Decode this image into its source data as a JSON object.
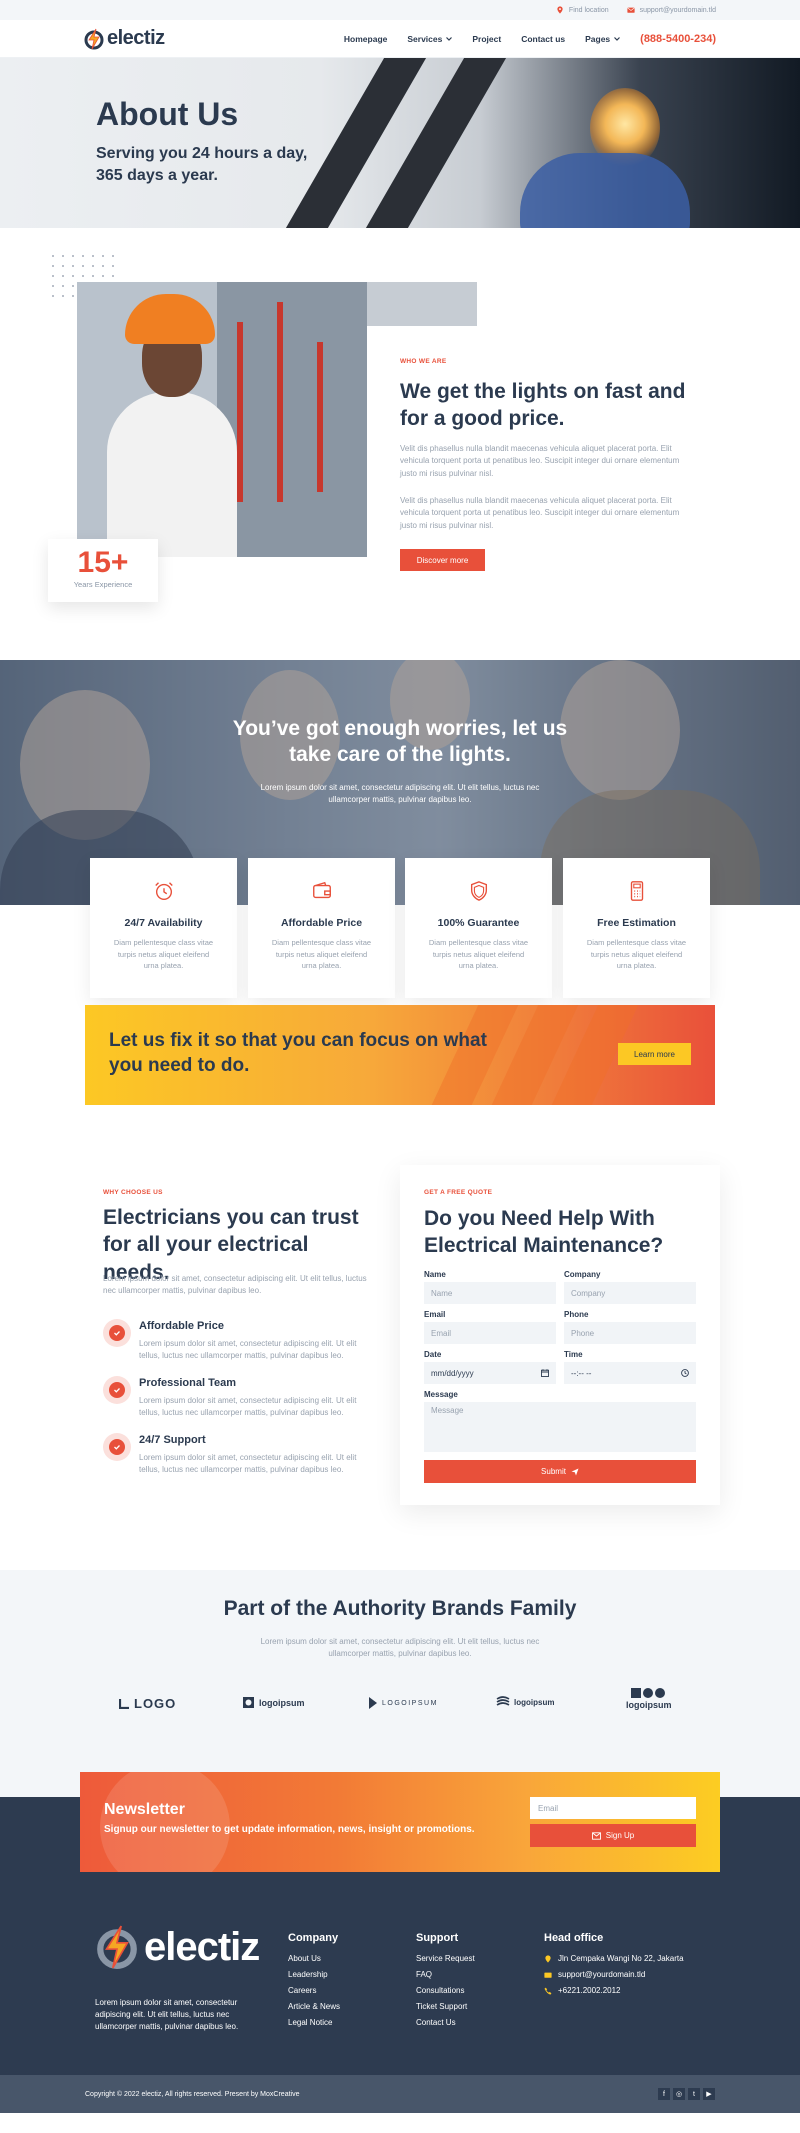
{
  "topbar": {
    "location": "Find location",
    "email": "support@yourdomain.tld"
  },
  "header": {
    "logo": "electiz",
    "nav": [
      "Homepage",
      "Services",
      "Project",
      "Contact us",
      "Pages"
    ],
    "phone": "(888-5400-234)"
  },
  "hero": {
    "title": "About Us",
    "subtitle_line1": "Serving you 24 hours a day,",
    "subtitle_line2": "365 days a year."
  },
  "about": {
    "eyebrow": "WHO WE ARE",
    "title": "We get the lights on fast and for a good price.",
    "p1": "Velit dis phasellus nulla blandit maecenas vehicula aliquet placerat porta. Elit vehicula torquent porta ut penatibus leo. Suscipit integer dui ornare elementum justo mi risus pulvinar nisl.",
    "p2": "Velit dis phasellus nulla blandit maecenas vehicula aliquet placerat porta. Elit vehicula torquent porta ut penatibus leo. Suscipit integer dui ornare elementum justo mi risus pulvinar nisl.",
    "button": "Discover more",
    "exp_number": "15+",
    "exp_label": "Years Experience"
  },
  "worries": {
    "title_line1": "You’ve got enough worries, let us",
    "title_line2": "take care of the lights.",
    "text": "Lorem ipsum dolor sit amet, consectetur adipiscing elit. Ut elit tellus, luctus nec ullamcorper mattis, pulvinar dapibus leo."
  },
  "features": [
    {
      "title": "24/7 Availability",
      "text": "Diam pellentesque class vitae turpis netus aliquet eleifend urna platea.",
      "icon": "alarm-clock-icon"
    },
    {
      "title": "Affordable Price",
      "text": "Diam pellentesque class vitae turpis netus aliquet eleifend urna platea.",
      "icon": "wallet-icon"
    },
    {
      "title": "100% Guarantee",
      "text": "Diam pellentesque class vitae turpis netus aliquet eleifend urna platea.",
      "icon": "shield-icon"
    },
    {
      "title": "Free Estimation",
      "text": "Diam pellentesque class vitae turpis netus aliquet eleifend urna platea.",
      "icon": "calculator-icon"
    }
  ],
  "banner": {
    "title": "Let us fix it so that you can focus on what you need to do.",
    "button": "Learn more"
  },
  "choose": {
    "eyebrow": "WHY CHOOSE US",
    "title": "Electricians you can trust for all your electrical needs.",
    "intro": "Lorem ipsum dolor sit amet, consectetur adipiscing elit. Ut elit tellus, luctus nec ullamcorper mattis, pulvinar dapibus leo.",
    "reasons": [
      {
        "title": "Affordable Price",
        "text": "Lorem ipsum dolor sit amet, consectetur adipiscing elit. Ut elit tellus, luctus nec ullamcorper mattis, pulvinar dapibus leo."
      },
      {
        "title": "Professional Team",
        "text": "Lorem ipsum dolor sit amet, consectetur adipiscing elit. Ut elit tellus, luctus nec ullamcorper mattis, pulvinar dapibus leo."
      },
      {
        "title": "24/7 Support",
        "text": "Lorem ipsum dolor sit amet, consectetur adipiscing elit. Ut elit tellus, luctus nec ullamcorper mattis, pulvinar dapibus leo."
      }
    ]
  },
  "quote": {
    "eyebrow": "GET A FREE QUOTE",
    "title": "Do you Need Help With Electrical Maintenance?",
    "name_label": "Name",
    "name_placeholder": "Name",
    "company_label": "Company",
    "company_placeholder": "Company",
    "email_label": "Email",
    "email_placeholder": "Email",
    "phone_label": "Phone",
    "phone_placeholder": "Phone",
    "date_label": "Date",
    "date_value": "mm/dd/yyyy",
    "time_label": "Time",
    "time_value": "--:-- --",
    "message_label": "Message",
    "message_placeholder": "Message",
    "submit": "Submit"
  },
  "brands": {
    "title": "Part of the Authority Brands Family",
    "text": "Lorem ipsum dolor sit amet, consectetur adipiscing elit. Ut elit tellus, luctus nec ullamcorper mattis, pulvinar dapibus leo.",
    "logos": [
      "LOGO",
      "logoipsum",
      "LOGOIPSUM",
      "logoipsum",
      "logoipsum"
    ]
  },
  "newsletter": {
    "title": "Newsletter",
    "text": "Signup our newsletter to get update information, news, insight or promotions.",
    "email_placeholder": "Email",
    "button": "Sign Up"
  },
  "footer": {
    "logo": "electiz",
    "desc": "Lorem ipsum dolor sit amet, consectetur adipiscing elit. Ut elit tellus, luctus nec ullamcorper mattis, pulvinar dapibus leo.",
    "company_title": "Company",
    "company_links": [
      "About Us",
      "Leadership",
      "Careers",
      "Article & News",
      "Legal Notice"
    ],
    "support_title": "Support",
    "support_links": [
      "Service Request",
      "FAQ",
      "Consultations",
      "Ticket Support",
      "Contact Us"
    ],
    "office_title": "Head office",
    "address": "Jln Cempaka Wangi No 22, Jakarta",
    "email": "support@yourdomain.tld",
    "phone": "+6221.2002.2012",
    "copyright": "Copyright © 2022 electiz, All rights reserved. Present by MoxCreative"
  },
  "colors": {
    "accent": "#e8503a",
    "navy": "#2d3b50",
    "yellow": "#fcc824"
  }
}
